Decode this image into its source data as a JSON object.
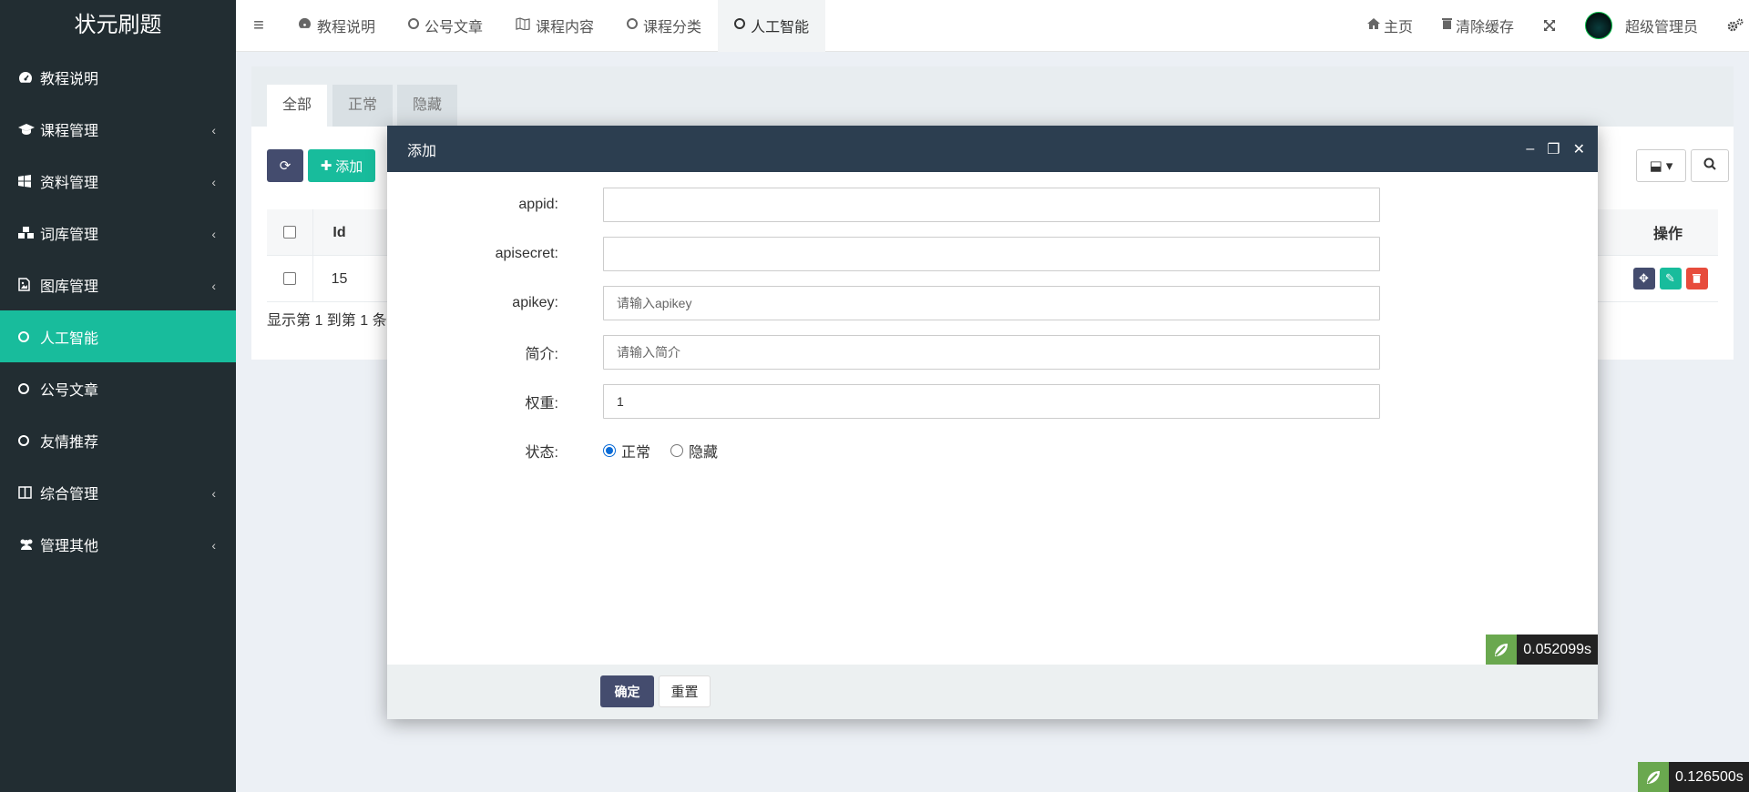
{
  "app": {
    "title": "状元刷题"
  },
  "sidebar": {
    "items": [
      {
        "label": "教程说明",
        "icon": "dashboard-icon",
        "expandable": false,
        "active": false
      },
      {
        "label": "课程管理",
        "icon": "graduation-cap-icon",
        "expandable": true,
        "active": false
      },
      {
        "label": "资料管理",
        "icon": "windows-icon",
        "expandable": true,
        "active": false
      },
      {
        "label": "词库管理",
        "icon": "cubes-icon",
        "expandable": true,
        "active": false
      },
      {
        "label": "图库管理",
        "icon": "image-file-icon",
        "expandable": true,
        "active": false
      },
      {
        "label": "人工智能",
        "icon": "circle-icon",
        "expandable": false,
        "active": true
      },
      {
        "label": "公号文章",
        "icon": "circle-icon",
        "expandable": false,
        "active": false
      },
      {
        "label": "友情推荐",
        "icon": "circle-icon",
        "expandable": false,
        "active": false
      },
      {
        "label": "综合管理",
        "icon": "columns-icon",
        "expandable": true,
        "active": false
      },
      {
        "label": "管理其他",
        "icon": "users-icon",
        "expandable": true,
        "active": false
      }
    ],
    "chevron": "‹"
  },
  "topbar": {
    "tabs": [
      {
        "label": "教程说明",
        "icon": "dashboard-icon"
      },
      {
        "label": "公号文章",
        "icon": "circle-icon"
      },
      {
        "label": "课程内容",
        "icon": "map-icon"
      },
      {
        "label": "课程分类",
        "icon": "circle-icon"
      },
      {
        "label": "人工智能",
        "icon": "circle-icon",
        "active": true
      }
    ],
    "home": "主页",
    "clear_cache": "清除缓存",
    "username": "超级管理员"
  },
  "panel": {
    "tabs": [
      "全部",
      "正常",
      "隐藏"
    ],
    "add_button": "添加",
    "table": {
      "headers": {
        "id": "Id",
        "actions": "操作"
      },
      "rows": [
        {
          "id": "15"
        }
      ]
    },
    "summary": "显示第 1 到第 1 条"
  },
  "modal": {
    "title": "添加",
    "fields": {
      "appid": {
        "label": "appid:",
        "value": "",
        "placeholder": ""
      },
      "apisecret": {
        "label": "apisecret:",
        "value": "",
        "placeholder": ""
      },
      "apikey": {
        "label": "apikey:",
        "value": "",
        "placeholder": "请输入apikey"
      },
      "intro": {
        "label": "简介:",
        "value": "",
        "placeholder": "请输入简介"
      },
      "weight": {
        "label": "权重:",
        "value": "1",
        "placeholder": ""
      }
    },
    "status": {
      "label": "状态:",
      "options": [
        "正常",
        "隐藏"
      ],
      "selected": "正常"
    },
    "confirm": "确定",
    "reset": "重置"
  },
  "timers": {
    "inner": "0.052099s",
    "outer": "0.126500s"
  },
  "colors": {
    "sidebar_bg": "#222d32",
    "active": "#18bc9c",
    "modal_header": "#2c3e50",
    "primary_btn": "#444c6e",
    "danger": "#e74c3c"
  }
}
